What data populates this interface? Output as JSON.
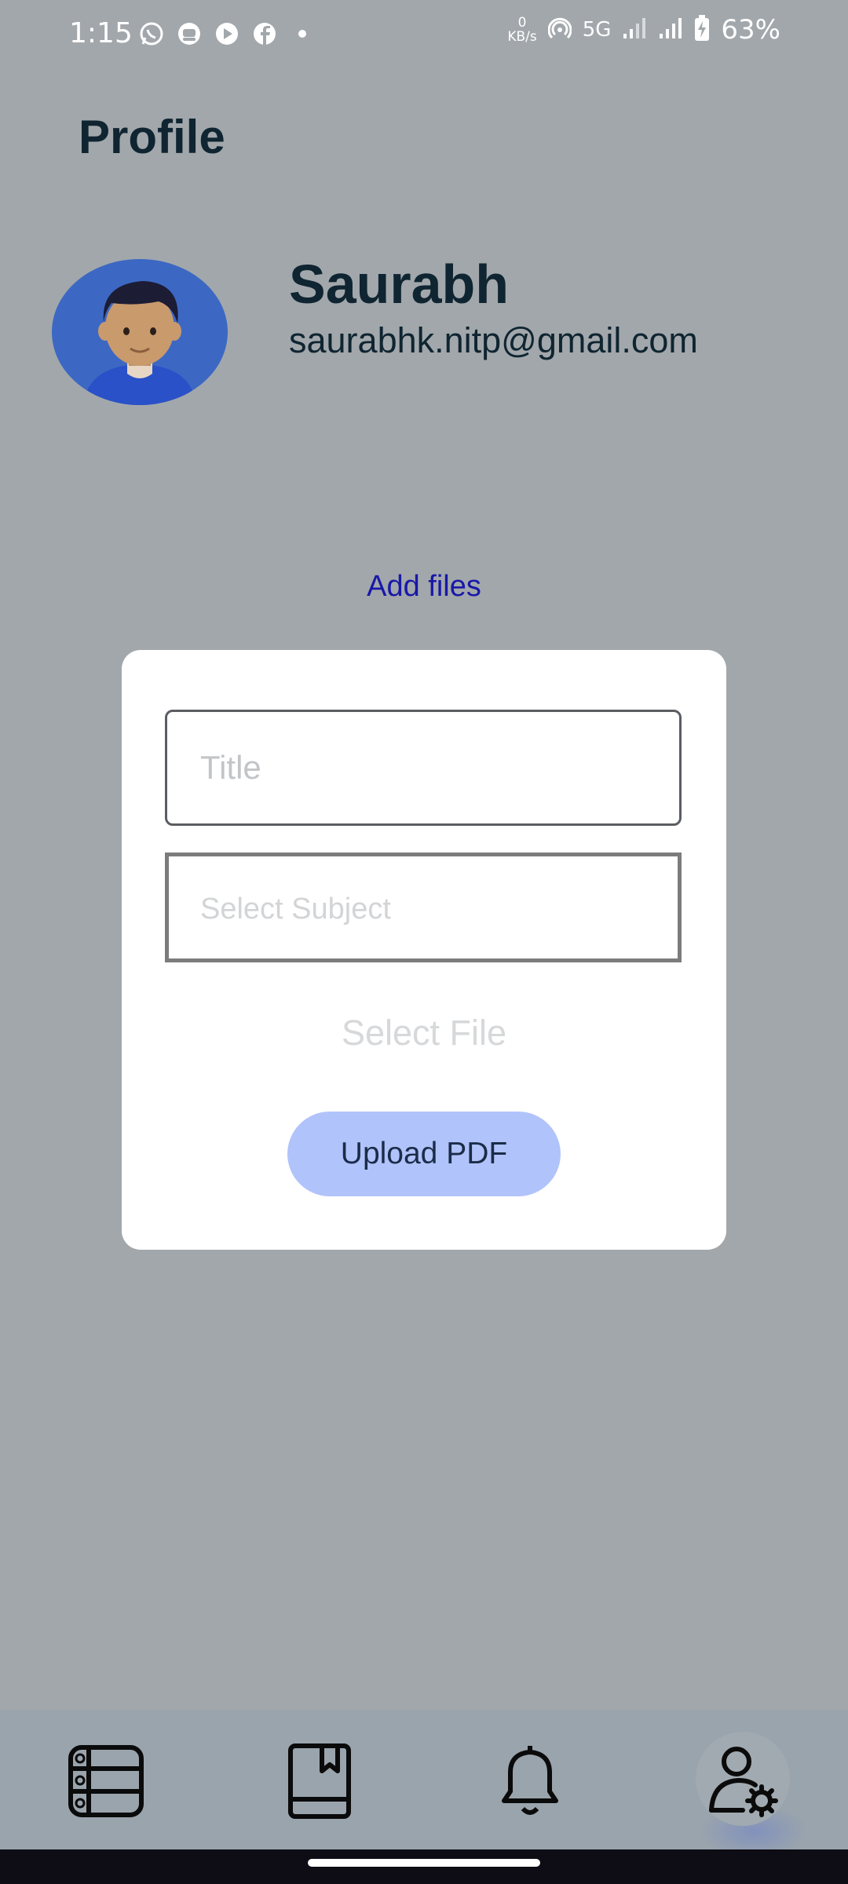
{
  "status_bar": {
    "time": "1:15",
    "net_speed_value": "0",
    "net_speed_unit": "KB/s",
    "network": "5G",
    "battery": "63%",
    "left_icons": [
      "whatsapp-icon",
      "chat-bot-icon",
      "youtube-icon",
      "facebook-icon",
      "dot-icon"
    ]
  },
  "page": {
    "title": "Profile"
  },
  "user": {
    "name": "Saurabh",
    "email": "saurabhk.nitp@gmail.com"
  },
  "add_files": {
    "label": "Add files",
    "title_placeholder": "Title",
    "subject_placeholder": "Select Subject",
    "select_file_label": "Select File",
    "upload_button": "Upload PDF"
  },
  "bottom_nav": {
    "items": [
      "list-icon",
      "book-icon",
      "bell-icon",
      "user-settings-icon"
    ],
    "active_item": "user-settings-icon"
  },
  "colors": {
    "background": "#a2a7ab",
    "link": "#1818a8",
    "button": "#b1c3fb",
    "card": "#ffffff"
  }
}
